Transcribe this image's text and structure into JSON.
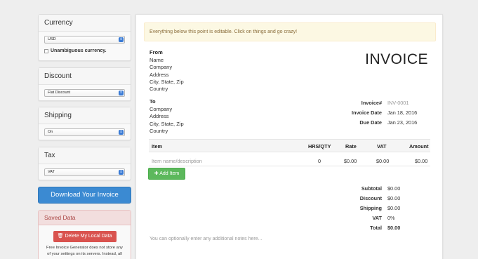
{
  "sidebar": {
    "currency": {
      "heading": "Currency",
      "value": "USD",
      "unambiguous_label": "Unambiguous currency."
    },
    "discount": {
      "heading": "Discount",
      "value": "Flat Discount"
    },
    "shipping": {
      "heading": "Shipping",
      "value": "On"
    },
    "tax": {
      "heading": "Tax",
      "value": "VAT"
    },
    "download_label": "Download Your Invoice",
    "saved": {
      "heading": "Saved Data",
      "delete_label": "Delete My Local Data",
      "text": "Free Invoice Generator does not store any of your settings on its servers. Instead, all"
    }
  },
  "invoice": {
    "notice": "Everything below this point is editable. Click on things and go crazy!",
    "title": "INVOICE",
    "from": {
      "label": "From",
      "lines": [
        "Name",
        "Company",
        "Address",
        "City, State, Zip",
        "Country"
      ]
    },
    "to": {
      "label": "To",
      "lines": [
        "Company",
        "Address",
        "City, State, Zip",
        "Country"
      ]
    },
    "meta": {
      "number_label": "Invoice#",
      "number_placeholder": "INV-0001",
      "date_label": "Invoice Date",
      "date_value": "Jan 18, 2016",
      "due_label": "Due Date",
      "due_value": "Jan 23, 2016"
    },
    "table": {
      "headers": {
        "item": "Item",
        "qty": "HRS/QTY",
        "rate": "Rate",
        "vat": "VAT",
        "amount": "Amount"
      },
      "row": {
        "item_placeholder": "Item name/description",
        "qty": "0",
        "rate": "$0.00",
        "vat": "$0.00",
        "amount": "$0.00"
      }
    },
    "add_item_label": "Add Item",
    "totals": {
      "subtotal_label": "Subtotal",
      "subtotal": "$0.00",
      "discount_label": "Discount",
      "discount": "$0.00",
      "shipping_label": "Shipping",
      "shipping": "$0.00",
      "vat_label": "VAT",
      "vat": "0%",
      "total_label": "Total",
      "total": "$0.00"
    },
    "notes_placeholder": "You can optionally enter any additional notes here..."
  },
  "colors": {
    "primary": "#3b8ad2",
    "success": "#5cb85c",
    "danger": "#d9534f",
    "warning_bg": "#fcf8e3"
  }
}
